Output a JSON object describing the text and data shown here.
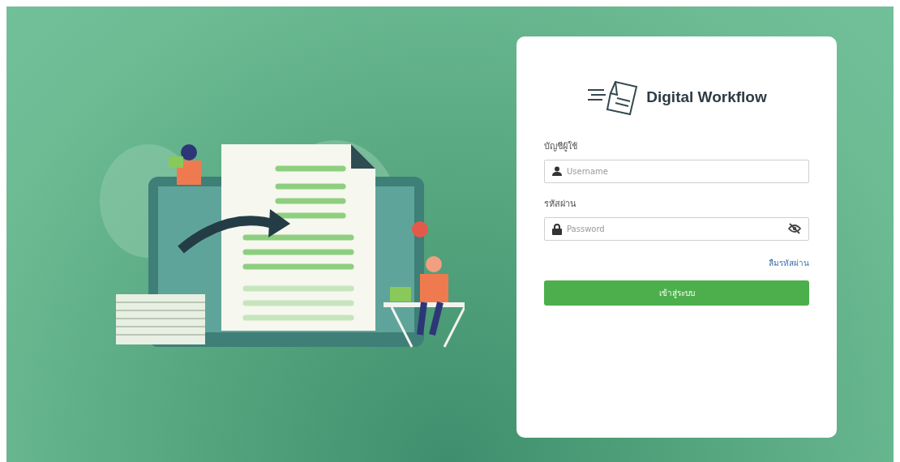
{
  "brand": {
    "name": "Digital Workflow"
  },
  "form": {
    "fields": [
      {
        "kind": "user",
        "label": "บัญชีผู้ใช้",
        "placeholder": "Username"
      },
      {
        "kind": "password",
        "label": "รหัสผ่าน",
        "placeholder": "Password"
      }
    ],
    "forgot_link": "ลืมรหัสผ่าน",
    "submit": "เข้าสู่ระบบ"
  }
}
